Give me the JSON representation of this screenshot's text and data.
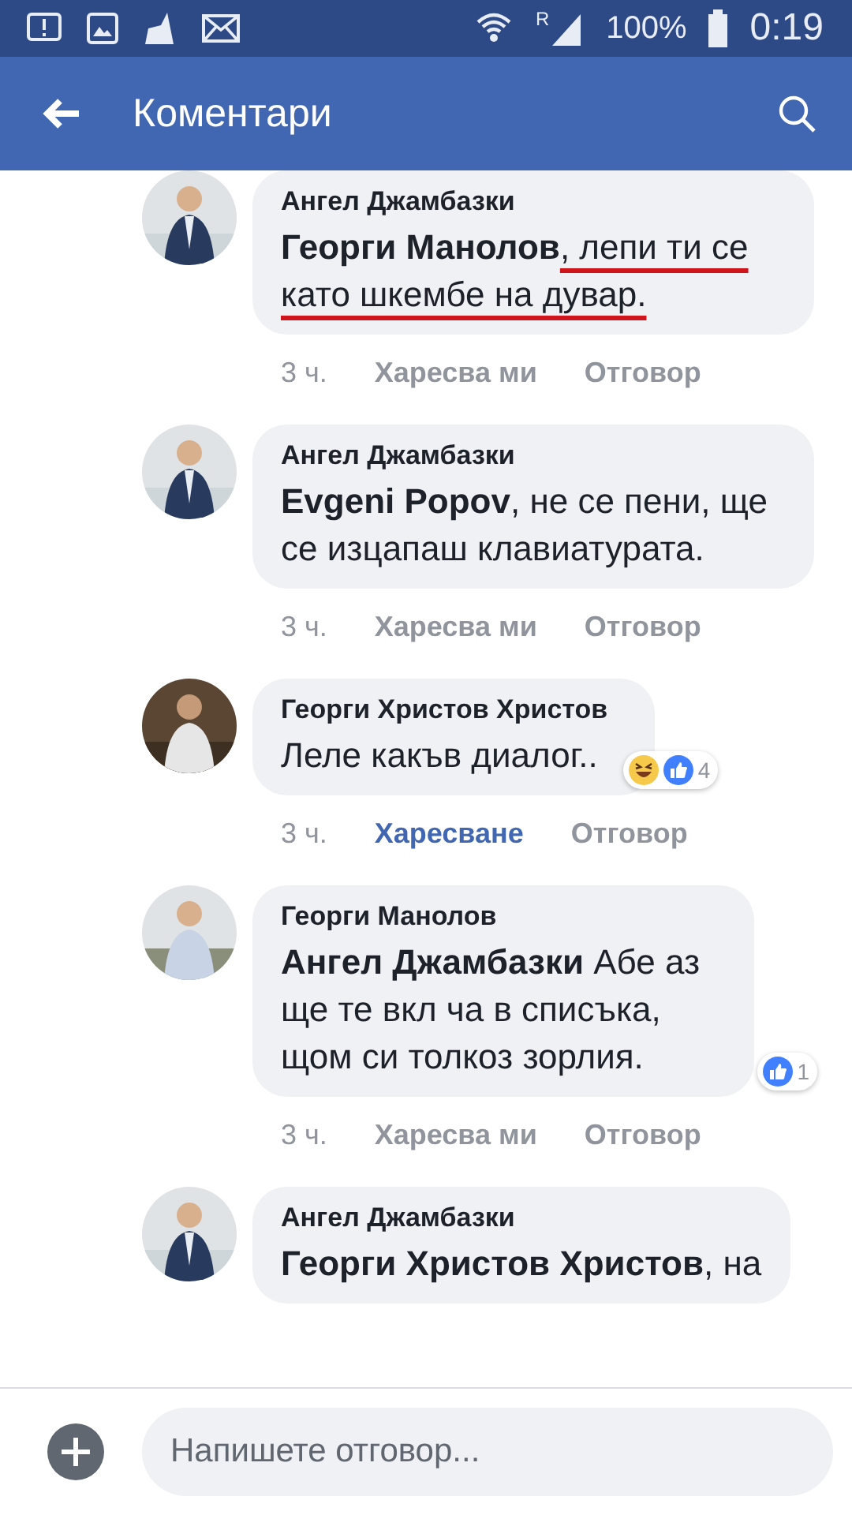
{
  "status_bar": {
    "battery": "100%",
    "time": "0:19",
    "network_label": "R"
  },
  "header": {
    "title": "Коментари"
  },
  "comments": [
    {
      "author": "Ангел Джамбазки",
      "mention": "Георги Манолов",
      "text": ", лепи ти се като шкембе на дувар.",
      "underlined": true,
      "time": "3 ч.",
      "like": {
        "label": "Харесва ми",
        "selected": false
      },
      "reply": "Отговор"
    },
    {
      "author": "Ангел Джамбазки",
      "mention": "Evgeni Popov",
      "text": ", не се пени, ще се изцапаш клавиатурата.",
      "underlined": false,
      "time": "3 ч.",
      "like": {
        "label": "Харесва ми",
        "selected": false
      },
      "reply": "Отговор"
    },
    {
      "author": "Георги Христов Христов",
      "text": "Леле какъв диалог..",
      "underlined": false,
      "time": "3 ч.",
      "like": {
        "label": "Харесване",
        "selected": true
      },
      "reply": "Отговор",
      "reactions": {
        "icons": [
          {
            "kind": "haha"
          },
          {
            "kind": "like"
          }
        ],
        "count": "4"
      }
    },
    {
      "author": "Георги Манолов",
      "mention": "Ангел Джамбазки",
      "text": " Абе аз ще те вкл ча в списъка, щом си толкоз зорлия.",
      "underlined": false,
      "time": "3 ч.",
      "like": {
        "label": "Харесва ми",
        "selected": false
      },
      "reply": "Отговор",
      "reactions": {
        "icons": [
          {
            "kind": "like"
          }
        ],
        "count": "1"
      }
    },
    {
      "author": "Ангел Джамбазки",
      "mention": "Георги Христов Христов",
      "text": ", на",
      "underlined": false
    }
  ],
  "composer": {
    "placeholder": "Напишете отговор..."
  }
}
